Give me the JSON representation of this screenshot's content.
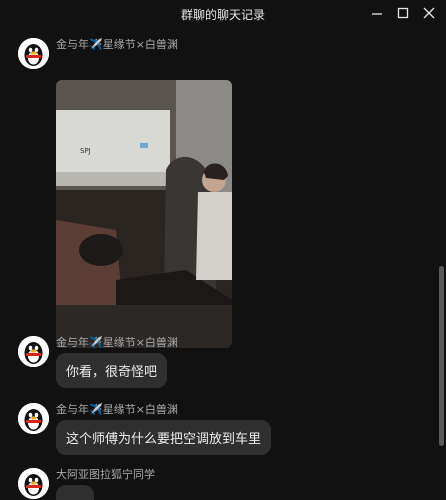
{
  "window": {
    "title": "群聊的聊天记录"
  },
  "messages": [
    {
      "sender": "金与年✈️星缘节×白兽渊",
      "type": "image"
    },
    {
      "sender": "金与年✈️星缘节×白兽渊",
      "text": "你看，很奇怪吧"
    },
    {
      "sender": "金与年✈️星缘节×白兽渊",
      "text": "这个师傅为什么要把空调放到车里"
    },
    {
      "sender": "大阿亚图拉狐宁同学",
      "text": ""
    }
  ],
  "image": {
    "brand_text": "SPJ"
  },
  "colors": {
    "background": "#111111",
    "bubble": "#2f2f2f",
    "sender_text": "#a9a9a9"
  }
}
